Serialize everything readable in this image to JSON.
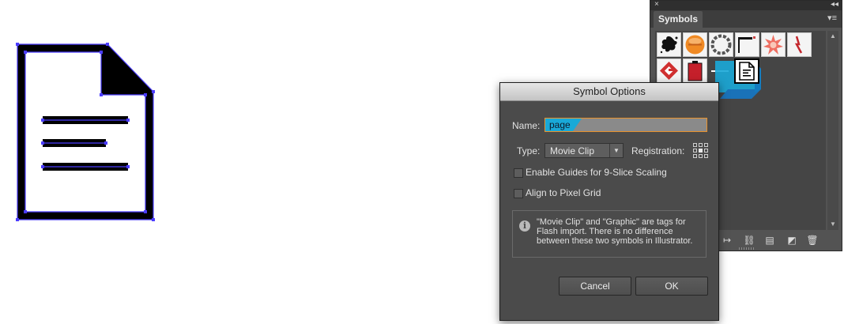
{
  "panel": {
    "tab_label": "Symbols",
    "close_glyph": "×",
    "collapse_glyph": "◂◂",
    "menu_glyph": "▾≡",
    "symbols": [
      "splatter",
      "orange-circle",
      "gear-ring",
      "flag-banner",
      "pink-burst",
      "red-zigzag",
      "red-diamond",
      "red-battery",
      "white-dash",
      "page"
    ],
    "selected_symbol": "page",
    "bottom_icons": [
      "place-instance-icon",
      "break-link-icon",
      "symbol-options-icon",
      "new-symbol-icon",
      "delete-symbol-icon"
    ]
  },
  "dialog": {
    "title": "Symbol Options",
    "name_label": "Name:",
    "name_value": "page",
    "type_label": "Type:",
    "type_value": "Movie Clip",
    "registration_label": "Registration:",
    "guides_label": "Enable Guides for 9-Slice Scaling",
    "pixel_grid_label": "Align to Pixel Grid",
    "info_text": "\"Movie Clip\" and \"Graphic\" are tags for Flash import. There is no difference between these two symbols in Illustrator.",
    "cancel_label": "Cancel",
    "ok_label": "OK"
  },
  "colors": {
    "dialog_bg": "#4b4b4b",
    "panel_bg": "#535353",
    "focus_orange": "#e8922c",
    "selection_blue": "#19a9d8",
    "anchor_blue": "#4b3cff"
  }
}
